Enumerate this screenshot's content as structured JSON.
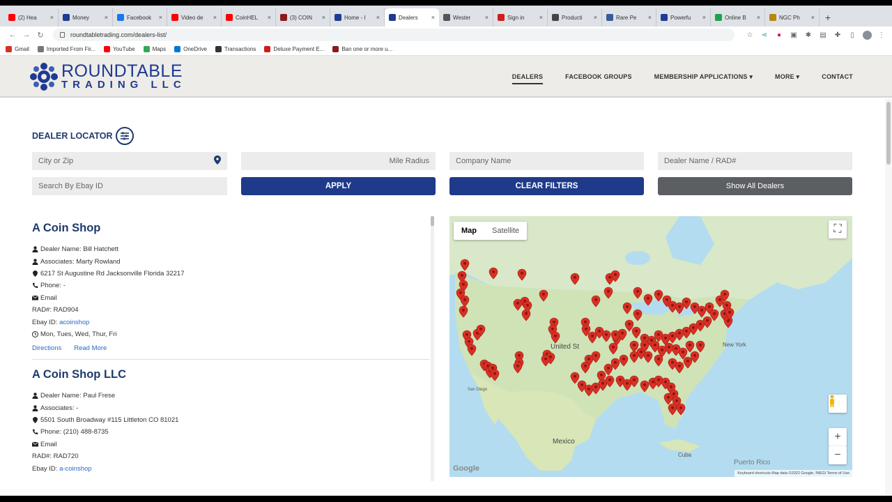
{
  "browser": {
    "tabs": [
      {
        "label": "(2) Hea",
        "color": "#ff0000"
      },
      {
        "label": "Money",
        "color": "#1f3a93"
      },
      {
        "label": "Facebook",
        "color": "#1877f2"
      },
      {
        "label": "Video de",
        "color": "#ff0000"
      },
      {
        "label": "CoinHEL",
        "color": "#ff0000"
      },
      {
        "label": "(3) COIN",
        "color": "#8b1a1a"
      },
      {
        "label": "Home - I",
        "color": "#1f3a93"
      },
      {
        "label": "Dealers",
        "color": "#1f3a93",
        "active": true
      },
      {
        "label": "Wester",
        "color": "#555555"
      },
      {
        "label": "Sign in",
        "color": "#d01c1c"
      },
      {
        "label": "Producti",
        "color": "#444444"
      },
      {
        "label": "Rare Pe",
        "color": "#3a5a9a"
      },
      {
        "label": "Powerfu",
        "color": "#1f3a93"
      },
      {
        "label": "Online B",
        "color": "#1aa34a"
      },
      {
        "label": "NGC Ph",
        "color": "#b8860b"
      }
    ],
    "url": "roundtabletrading.com/dealers-list/",
    "bookmarks": [
      {
        "label": "Gmail",
        "color": "#d93025"
      },
      {
        "label": "Imported From Fir...",
        "color": "#777777"
      },
      {
        "label": "YouTube",
        "color": "#ff0000"
      },
      {
        "label": "Maps",
        "color": "#34a853"
      },
      {
        "label": "OneDrive",
        "color": "#0078d4"
      },
      {
        "label": "Transactions",
        "color": "#333333"
      },
      {
        "label": "Deluxe Payment E...",
        "color": "#d01c1c"
      },
      {
        "label": "Ban one or more u...",
        "color": "#8b1a1a"
      }
    ]
  },
  "site": {
    "logo_line1": "ROUNDTABLE",
    "logo_line2": "TRADING LLC",
    "nav": [
      {
        "label": "DEALERS",
        "active": true
      },
      {
        "label": "FACEBOOK GROUPS"
      },
      {
        "label": "MEMBERSHIP APPLICATIONS ▾"
      },
      {
        "label": "MORE ▾"
      },
      {
        "label": "CONTACT"
      }
    ]
  },
  "locator": {
    "title": "DEALER LOCATOR",
    "city_placeholder": "City or Zip",
    "radius_placeholder": "Mile Radius",
    "company_placeholder": "Company Name",
    "dealer_placeholder": "Dealer Name / RAD#",
    "ebay_placeholder": "Search By Ebay ID",
    "apply": "APPLY",
    "clear": "CLEAR FILTERS",
    "show_all": "Show All Dealers"
  },
  "dealers": [
    {
      "name": "A Coin Shop",
      "dealer_name": "Dealer Name: Bill Hatchett",
      "associates": "Associates: Marty Rowland",
      "address": "6217 St Augustine Rd Jacksonville Florida 32217",
      "phone": "Phone: -",
      "email": "Email",
      "rad": "RAD#: RAD904",
      "ebay_label": "Ebay ID:",
      "ebay_id": "acoinshop",
      "hours": "Mon, Tues, Wed, Thur, Fri",
      "directions": "Directions",
      "read_more": "Read More"
    },
    {
      "name": "A Coin Shop LLC",
      "dealer_name": "Dealer Name: Paul Frese",
      "associates": "Associates: -",
      "address": "5501 South Broadway #115 Littleton CO 81021",
      "phone": "Phone: (210) 488-8735",
      "email": "Email",
      "rad": "RAD#: RAD720",
      "ebay_label": "Ebay ID:",
      "ebay_id": "a-coinshop"
    }
  ],
  "map": {
    "tab_map": "Map",
    "tab_satellite": "Satellite",
    "labels": {
      "united_states": "United St",
      "mexico": "Mexico",
      "new_york": "New York",
      "san_diego": "San Diego",
      "cuba": "Cuba",
      "puerto_rico": "Puerto Rico",
      "google": "Google"
    },
    "attribution": "Keyboard shortcuts   Map data ©2022 Google, INEGI   Terms of Use",
    "pin_color": "#d93025",
    "land_color": "#cfe3b7"
  }
}
